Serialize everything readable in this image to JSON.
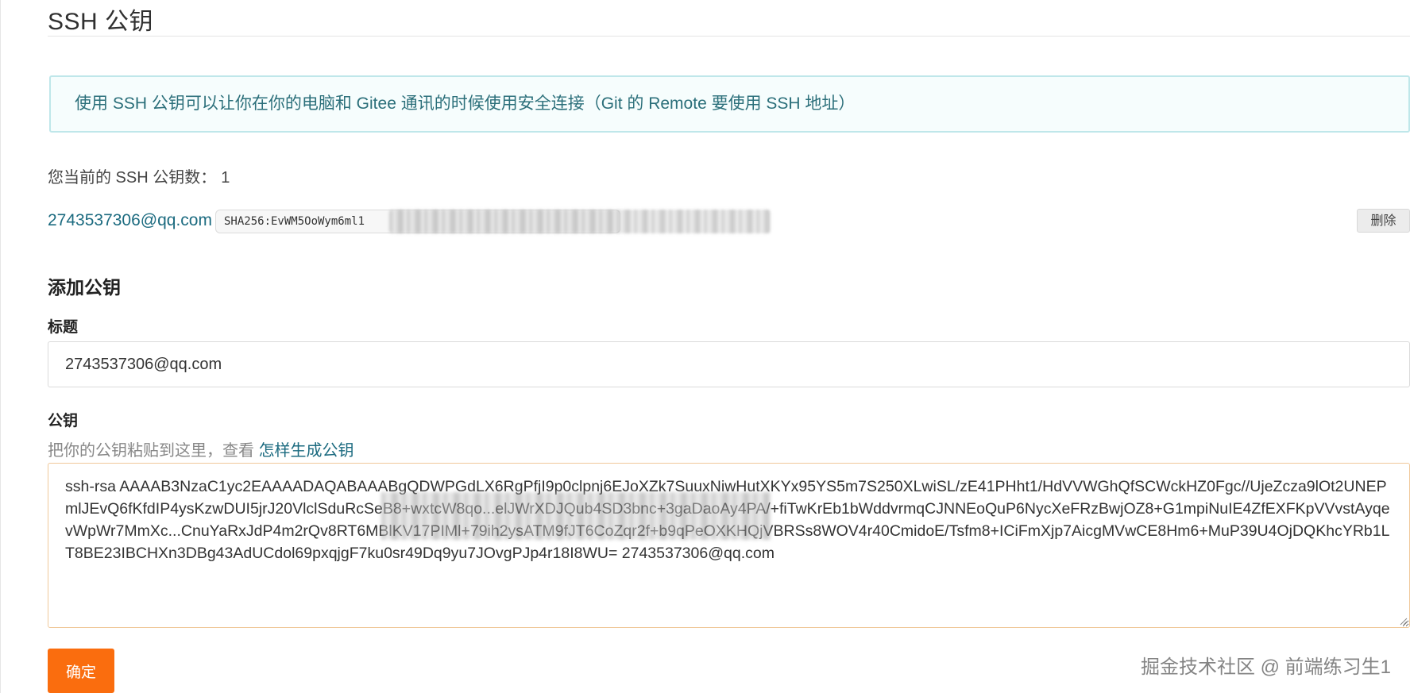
{
  "header": {
    "title": "SSH 公钥"
  },
  "notice": {
    "text": "使用 SSH 公钥可以让你在你的电脑和 Gitee 通讯的时候使用安全连接（Git 的 Remote 要使用 SSH 地址）"
  },
  "key_count": {
    "label": "您当前的 SSH 公钥数：",
    "value": "1"
  },
  "existing_key": {
    "email": "2743537306@qq.com",
    "fingerprint": "SHA256:EvWM5OoWym6ml1",
    "delete_label": "删除"
  },
  "add_key": {
    "section_title": "添加公钥",
    "title_label": "标题",
    "title_value": "2743537306@qq.com",
    "key_label": "公钥",
    "hint_text": "把你的公钥粘贴到这里，查看 ",
    "hint_link": "怎样生成公钥",
    "key_value": "ssh-rsa AAAAB3NzaC1yc2EAAAADAQABAAABgQDWPGdLX6RgPfjI9p0clpnj6EJoXZk7SuuxNiwHutXKYx95YS5m7S250XLwiSL/zE41PHht1/HdVVWGhQfSCWckHZ0Fgc//UjeZcza9lOt2UNEPmlJEvQ6fKfdIP4ysKzwDUI5jrJ20VlclSduRcSeB8+wxtcW8qo...elJWrXDJQub4SD3bnc+3gaDaoAy4PA/+fiTwKrEb1bWddvrmqCJNNEoQuP6NycXeFRzBwjOZ8+G1mpiNuIE4ZfEXFKpVVvstAyqevWpWr7MmXc...CnuYaRxJdP4m2rQv8RT6MBlKV17PIMl+79ih2ysATM9fJT6CoZqr2f+b9qPeOXKHQjVBRSs8WOV4r40CmidoE/Tsfm8+ICiFmXjp7AicgMVwCE8Hm6+MuP39U4OjDQKhcYRb1LT8BE23IBCHXn3DBg43AdUCdol69pxqjgF7ku0sr49Dq9yu7JOvgPJp4r18I8WU= 2743537306@qq.com",
    "confirm_label": "确定"
  },
  "watermark": {
    "text": "掘金技术社区 @ 前端练习生1"
  },
  "colors": {
    "link": "#1c6b80",
    "notice_border": "#bfe7ea",
    "notice_bg": "#f6fdfd",
    "primary_button": "#fa6d0e",
    "textarea_border_focus": "#f0c89a"
  }
}
